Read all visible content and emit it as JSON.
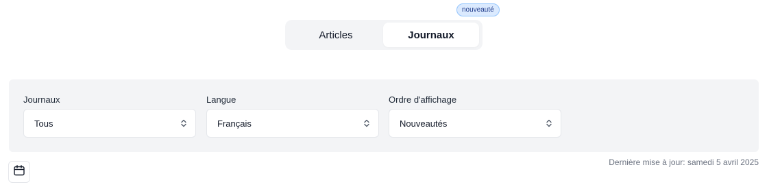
{
  "tabs": {
    "items": [
      {
        "label": "Articles",
        "active": false
      },
      {
        "label": "Journaux",
        "active": true
      }
    ],
    "badge": "nouveauté"
  },
  "filters": {
    "journaux": {
      "label": "Journaux",
      "value": "Tous"
    },
    "langue": {
      "label": "Langue",
      "value": "Français"
    },
    "ordre": {
      "label": "Ordre d'affichage",
      "value": "Nouveautés"
    }
  },
  "footer": {
    "calendar_icon": "calendar-icon",
    "last_update": "Dernière mise à jour: samedi 5 avril 2025"
  },
  "colors": {
    "badge_bg": "#dbeafe",
    "badge_text": "#1e3a8a",
    "panel_bg": "#f3f4f6"
  }
}
